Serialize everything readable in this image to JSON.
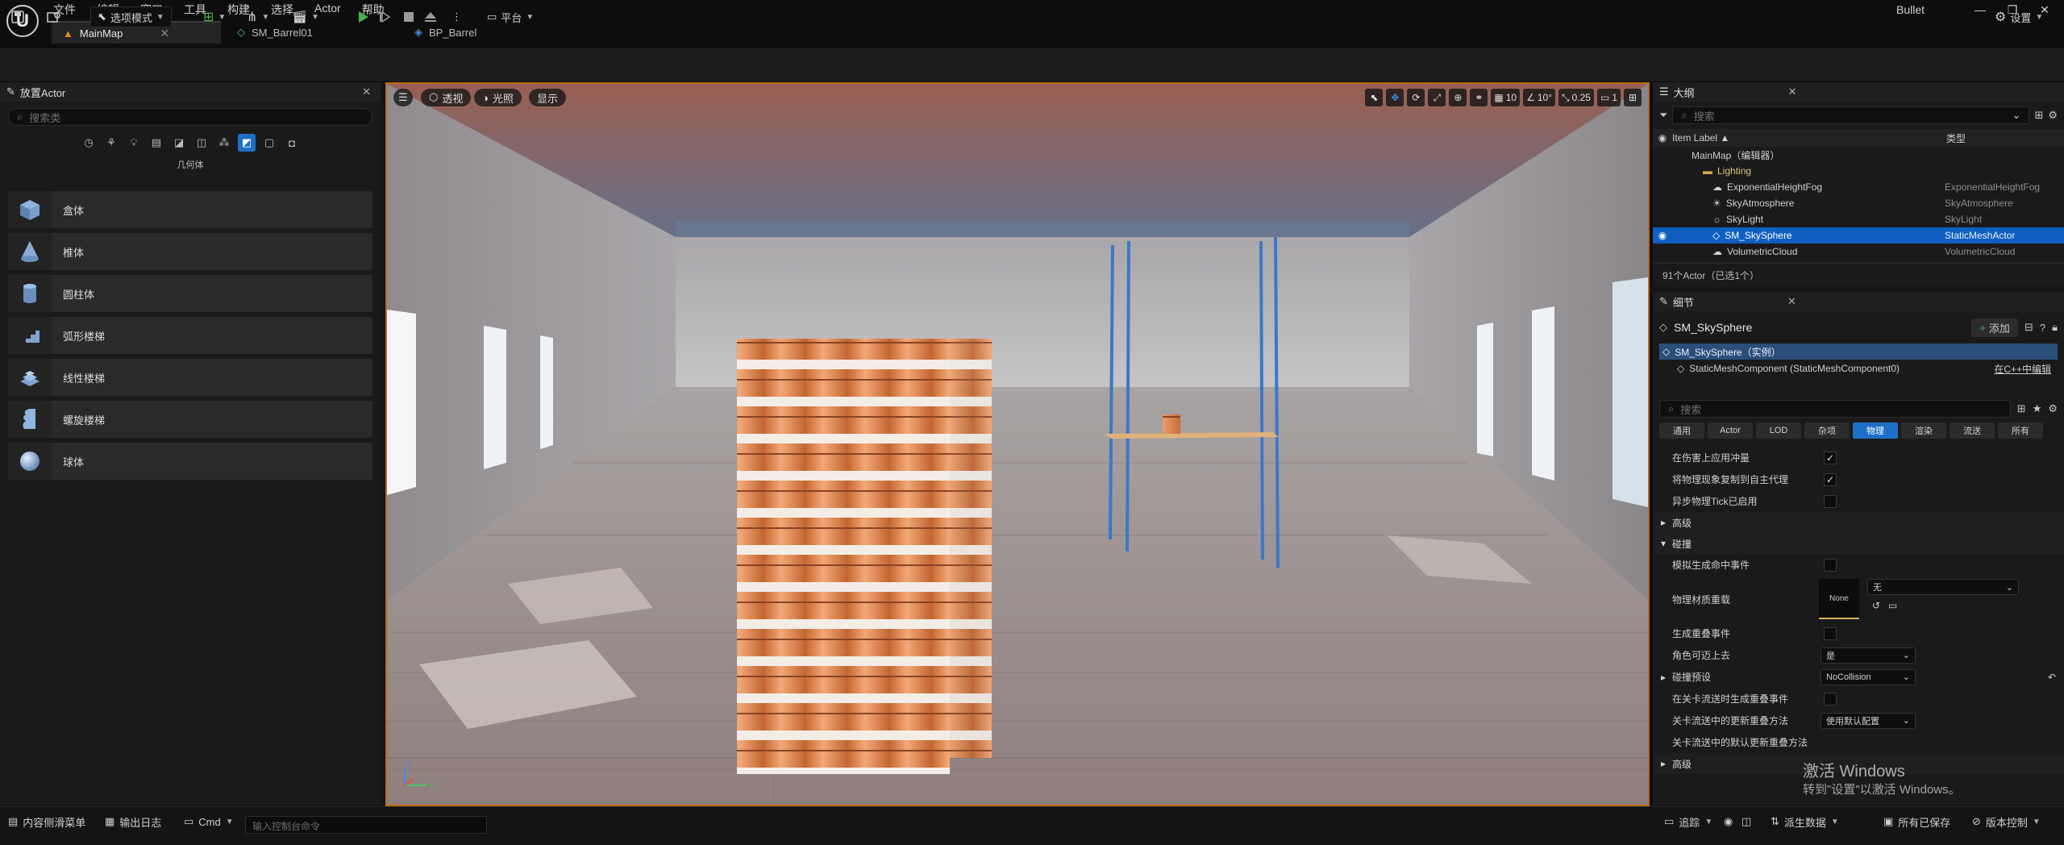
{
  "menu": {
    "items": [
      "文件",
      "编辑",
      "窗口",
      "工具",
      "构建",
      "选择",
      "Actor",
      "帮助"
    ],
    "project_name": "Bullet"
  },
  "tabs": [
    {
      "label": "MainMap",
      "active": true
    },
    {
      "label": "SM_Barrel01",
      "active": false
    },
    {
      "label": "BP_Barrel",
      "active": false
    }
  ],
  "toolbar": {
    "mode_label": "选项模式",
    "platform_label": "平台",
    "settings_label": "设置"
  },
  "place_actors": {
    "title": "放置Actor",
    "search_placeholder": "搜索类",
    "category_title": "几何体",
    "items": [
      "盒体",
      "椎体",
      "圆柱体",
      "弧形楼梯",
      "线性楼梯",
      "螺旋楼梯",
      "球体"
    ]
  },
  "viewport": {
    "perspective_label": "透视",
    "lighting_label": "光照",
    "show_label": "显示",
    "grid_snap": "10",
    "rotation_snap": "10°",
    "scale_snap": "0.25",
    "camera_speed": "1"
  },
  "outliner": {
    "title": "大纲",
    "search_placeholder": "搜索",
    "col_label": "Item Label ▲",
    "col_type": "类型",
    "rows": [
      {
        "label": "MainMap（编辑器）",
        "type": ""
      },
      {
        "label": "Lighting",
        "type": ""
      },
      {
        "label": "ExponentialHeightFog",
        "type": "ExponentialHeightFog"
      },
      {
        "label": "SkyAtmosphere",
        "type": "SkyAtmosphere"
      },
      {
        "label": "SkyLight",
        "type": "SkyLight"
      },
      {
        "label": "SM_SkySphere",
        "type": "StaticMeshActor"
      },
      {
        "label": "VolumetricCloud",
        "type": "VolumetricCloud"
      }
    ],
    "count": "91个Actor（已选1个）"
  },
  "details": {
    "title": "细节",
    "actor_name": "SM_SkySphere",
    "add_label": "添加",
    "instance_label": "SM_SkySphere（实例）",
    "component_label": "StaticMeshComponent (StaticMeshComponent0)",
    "cpp_link": "在C++中编辑",
    "search_placeholder": "搜索",
    "filter_tabs": [
      "通用",
      "Actor",
      "LOD",
      "杂项",
      "物理",
      "渲染",
      "流送",
      "所有"
    ],
    "props": {
      "apply_impulse": "在伤害上应用冲量",
      "replicate_physics": "将物理现象复制到自主代理",
      "async_tick": "异步物理Tick已启用",
      "advanced": "高级",
      "collision": "碰撞",
      "sim_hit_events": "模拟生成命中事件",
      "phys_material": "物理材质重载",
      "material_value": "无",
      "thumb_none": "None",
      "overlap_events": "生成重叠事件",
      "can_step_up": "角色可迈上去",
      "can_step_up_value": "是",
      "collision_preset": "碰撞预设",
      "collision_preset_value": "NoCollision",
      "level_overlap": "在关卡流送时生成重叠事件",
      "update_overlap": "关卡流送中的更新重叠方法",
      "update_overlap_value": "使用默认配置",
      "default_overlap": "关卡流送中的默认更新重叠方法",
      "advanced2": "高级"
    }
  },
  "bottom": {
    "content_drawer": "内容侧滑菜单",
    "output_log": "输出日志",
    "cmd": "Cmd",
    "cmd_placeholder": "输入控制台命令",
    "trace": "追踪",
    "derived_data": "派生数据",
    "all_saved": "所有已保存",
    "source_control": "版本控制"
  },
  "watermark": {
    "line1": "激活 Windows",
    "line2": "转到\"设置\"以激活 Windows。"
  },
  "colors": {
    "accent_blue": "#1d6fc7",
    "viewport_border": "#b96d0d",
    "play_green": "#4caf50"
  }
}
